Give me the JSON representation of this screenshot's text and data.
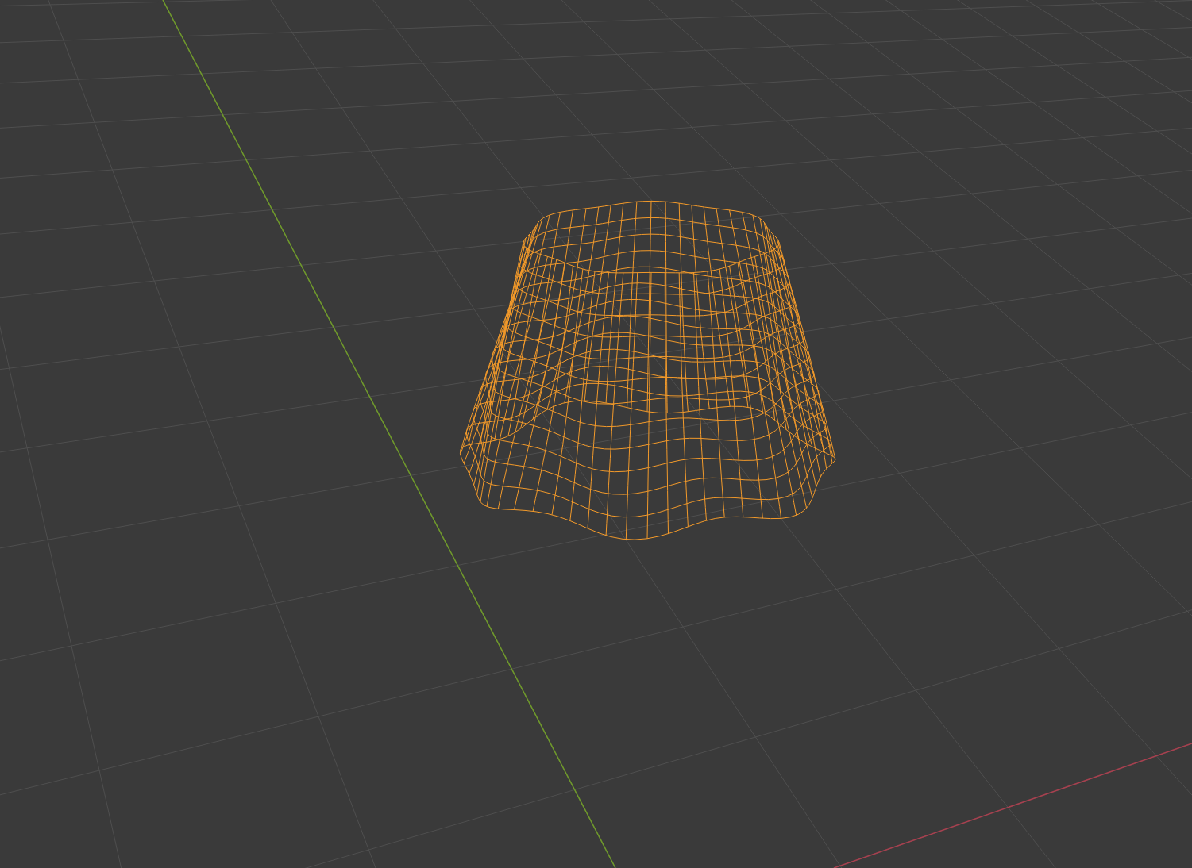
{
  "mesh": {
    "selected": true
  }
}
